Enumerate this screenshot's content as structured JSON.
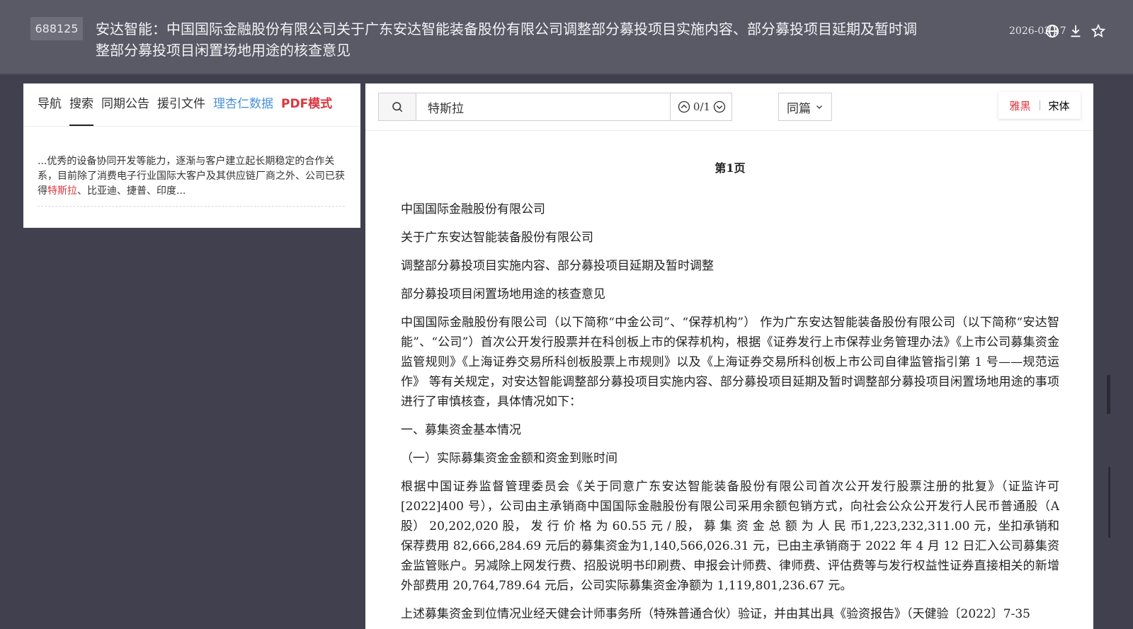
{
  "header": {
    "stock_code": "688125",
    "title": "安达智能：中国国际金融股份有限公司关于广东安达智能装备股份有限公司调整部分募投项目实施内容、部分募投项目延期及暂时调整部分募投项目闲置场地用途的核查意见",
    "date": "2026-03-17",
    "icons": [
      "globe-icon",
      "download-icon",
      "star-icon"
    ]
  },
  "left_panel": {
    "tabs": [
      {
        "label": "导航"
      },
      {
        "label": "搜索"
      },
      {
        "label": "同期公告"
      },
      {
        "label": "援引文件"
      },
      {
        "label": "理杏仁数据"
      },
      {
        "label": "PDF模式"
      }
    ],
    "active_tab": "搜索",
    "result": {
      "before": "...优秀的设备协同开发等能力，逐渐与客户建立起长期稳定的合作关系，目前除了消费电子行业国际大客户及其供应链厂商之外、公司已获得",
      "match": "特斯拉",
      "after": "、比亚迪、捷普、印度..."
    }
  },
  "toolbar": {
    "search_value": "特斯拉",
    "match_count": "0/1",
    "scope": "同篇",
    "font_options": [
      "雅黑",
      "宋体"
    ],
    "active_font": "雅黑"
  },
  "document": {
    "page_label": "第1页",
    "paragraphs": [
      "中国国际金融股份有限公司",
      "关于广东安达智能装备股份有限公司",
      "调整部分募投项目实施内容、部分募投项目延期及暂时调整",
      "部分募投项目闲置场地用途的核查意见",
      "中国国际金融股份有限公司（以下简称“中金公司”、“保荐机构”） 作为广东安达智能装备股份有限公司（以下简称“安达智能”、“公司”）首次公开发行股票并在科创板上市的保荐机构，根据《证券发行上市保荐业务管理办法》《上市公司募集资金监管规则》《上海证券交易所科创板股票上市规则》以及《上海证券交易所科创板上市公司自律监管指引第 1 号——规范运作》 等有关规定，对安达智能调整部分募投项目实施内容、部分募投项目延期及暂时调整部分募投项目闲置场地用途的事项进行了审慎核查，具体情况如下：",
      "一、募集资金基本情况",
      "（一）实际募集资金金额和资金到账时间",
      "根据中国证券监督管理委员会《关于同意广东安达智能装备股份有限公司首次公开发行股票注册的批复》（证监许可[2022]400 号），公司由主承销商中国国际金融股份有限公司采用余额包销方式，向社会公众公开发行人民币普通股（A 股） 20,202,020 股， 发 行 价 格 为 60.55 元 / 股， 募 集 资 金 总 额 为 人 民 币1,223,232,311.00 元，坐扣承销和保荐费用 82,666,284.69 元后的募集资金为1,140,566,026.31 元，已由主承销商于 2022 年 4 月 12 日汇入公司募集资金监管账户。另减除上网发行费、招股说明书印刷费、申报会计师费、律师费、评估费等与发行权益性证券直接相关的新增外部费用 20,764,789.64 元后，公司实际募集资金净额为 1,119,801,236.67 元。",
      "上述募集资金到位情况业经天健会计师事务所（特殊普通合伙）验证，并由其出具《验资报告》（天健验〔2022〕7-35"
    ]
  },
  "colors": {
    "accent_red": "#d9363e",
    "accent_blue": "#4a90d9",
    "header_bg": "#5a5a67",
    "page_bg": "#40404f"
  }
}
